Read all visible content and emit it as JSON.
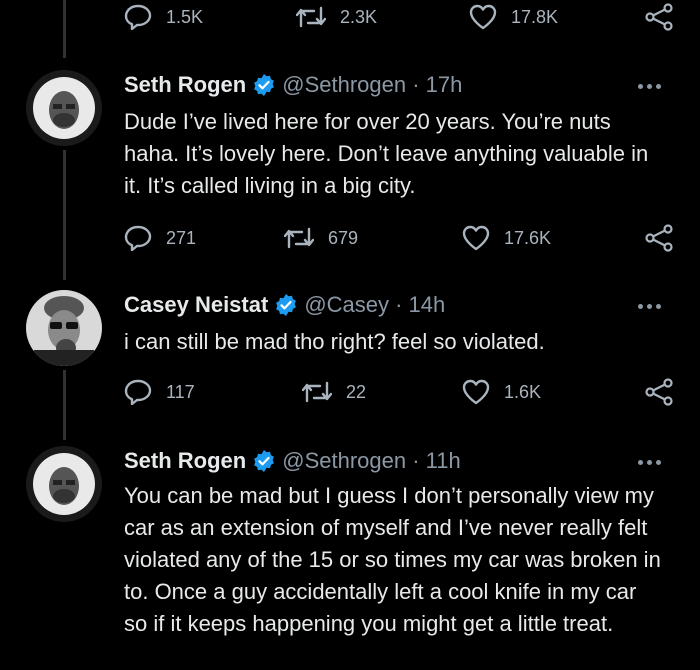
{
  "top_actions": {
    "replies": "1.5K",
    "retweets": "2.3K",
    "likes": "17.8K"
  },
  "tweets": [
    {
      "name": "Seth Rogen",
      "handle": "@Sethrogen · 17h",
      "text": "Dude I’ve lived here for over 20 years. You’re nuts haha. It’s lovely here. Don’t leave anything valuable in it. It’s called living in a big city.",
      "replies": "271",
      "retweets": "679",
      "likes": "17.6K"
    },
    {
      "name": "Casey Neistat",
      "handle": "@Casey · 14h",
      "text": "i can still be mad tho right?  feel so violated.",
      "replies": "117",
      "retweets": "22",
      "likes": "1.6K"
    },
    {
      "name": "Seth Rogen",
      "handle": "@Sethrogen · 11h",
      "text": "You can be mad but I guess I don’t personally view my car as an extension of myself and I’ve never really felt violated any of the 15 or so times my car was broken in to. Once a guy accidentally left a cool knife in my car so if it keeps happening you might get a little treat."
    }
  ],
  "colors": {
    "background": "#000000",
    "text": "#e7e9ea",
    "muted": "#8b98a5",
    "verified": "#1d9bf0"
  }
}
